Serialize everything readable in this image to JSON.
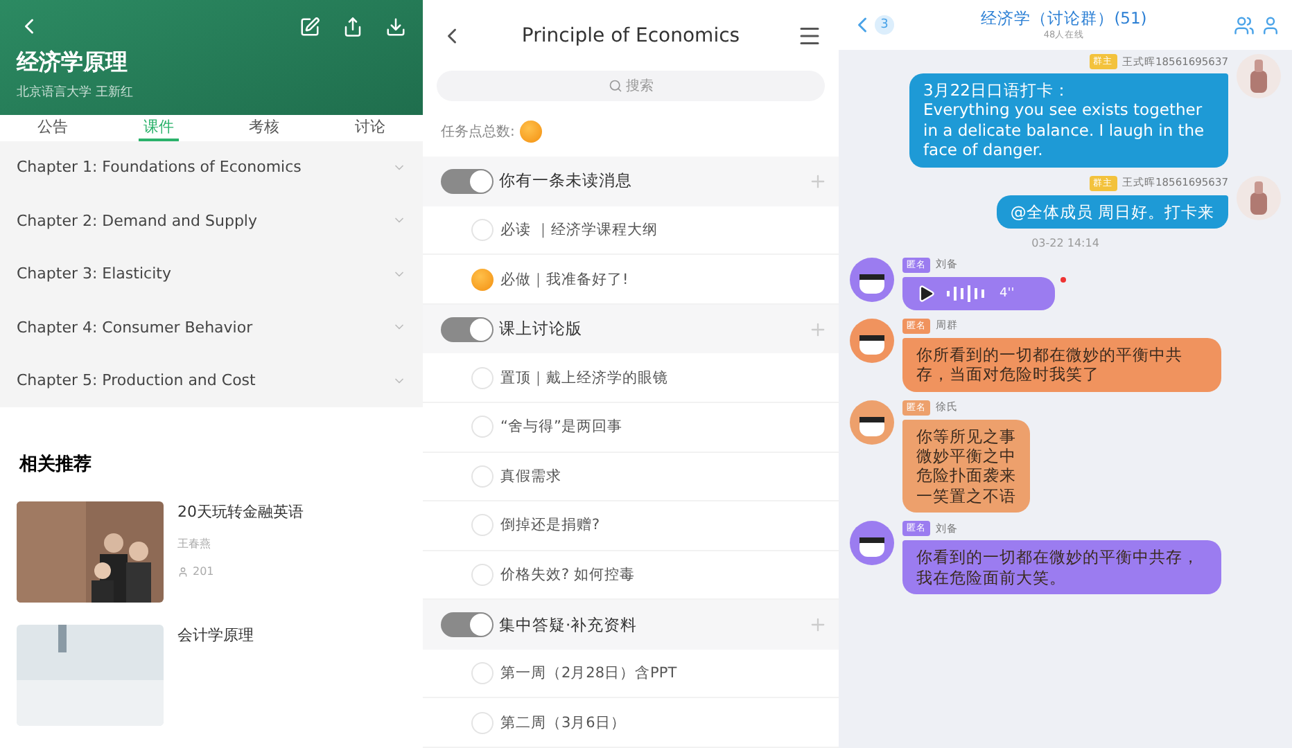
{
  "course": {
    "title": "经济学原理",
    "subtitle": "北京语言大学  王新红",
    "tabs": [
      {
        "label": "公告",
        "selected": false
      },
      {
        "label": "课件",
        "selected": true
      },
      {
        "label": "考核",
        "selected": false
      },
      {
        "label": "讨论",
        "selected": false
      }
    ],
    "chapters": [
      "Chapter 1: Foundations of Economics",
      "Chapter 2: Demand and Supply",
      "Chapter 3: Elasticity",
      "Chapter 4: Consumer Behavior",
      "Chapter 5: Production and Cost"
    ],
    "recommend_title": "相关推荐",
    "recommendations": [
      {
        "title": "20天玩转金融英语",
        "author": "王春燕",
        "count": "201"
      },
      {
        "title": "会计学原理"
      }
    ]
  },
  "tasks": {
    "title": "Principle of Economics",
    "search_placeholder": "搜索",
    "count_label": "任务点总数:",
    "groups": [
      {
        "title": "你有一条未读消息",
        "on": true,
        "items": [
          {
            "label": "必读 ｜经济学课程大纲",
            "marked": false
          },
          {
            "label": "必做｜我准备好了!",
            "marked": true
          }
        ]
      },
      {
        "title": "课上讨论版",
        "on": true,
        "items": [
          {
            "label": "置顶｜戴上经济学的眼镜",
            "marked": false
          },
          {
            "label": "“舍与得”是两回事",
            "marked": false
          },
          {
            "label": "真假需求",
            "marked": false
          },
          {
            "label": "倒掉还是捐赠?",
            "marked": false
          },
          {
            "label": "价格失效? 如何控毒",
            "marked": false
          }
        ]
      },
      {
        "title": "集中答疑·补充资料",
        "on": true,
        "items": [
          {
            "label": "第一周（2月28日）含PPT",
            "marked": false
          },
          {
            "label": "第二周（3月6日）",
            "marked": false
          }
        ]
      }
    ]
  },
  "chat": {
    "back_count": "3",
    "title": "经济学（讨论群）(51)",
    "online": "48人在线",
    "messages": [
      {
        "kind": "text",
        "outgoing": true,
        "badge": "群主",
        "sender": "王式晖18561695637",
        "color": "#1e9ad6",
        "text": "3月22日口语打卡：\nEverything you see exists together in a delicate balance. I laugh in the face of danger."
      },
      {
        "kind": "text",
        "outgoing": true,
        "badge": "群主",
        "sender": "王式晖18561695637",
        "color": "#1e9ad6",
        "text": "@全体成员 周日好。打卡来"
      },
      {
        "kind": "time",
        "text": "03-22 14:14"
      },
      {
        "kind": "voice",
        "outgoing": false,
        "badge": "匿名",
        "sender": "刘备",
        "color": "#9b7cf0",
        "duration": "4''",
        "unread": true
      },
      {
        "kind": "text",
        "outgoing": false,
        "badge": "匿名",
        "sender": "周群",
        "color": "#f0935e",
        "text": "你所看到的一切都在微妙的平衡中共存，当面对危险时我笑了"
      },
      {
        "kind": "text",
        "outgoing": false,
        "badge": "匿名",
        "sender": "徐氏",
        "color": "#eda06c",
        "lines": [
          "你等所见之事",
          "微妙平衡之中",
          "危险扑面袭来",
          "一笑置之不语"
        ]
      },
      {
        "kind": "text",
        "outgoing": false,
        "badge": "匿名",
        "sender": "刘备",
        "color": "#9b7cf0",
        "text": "你看到的一切都在微妙的平衡中共存，我在危险面前大笑。"
      }
    ]
  }
}
